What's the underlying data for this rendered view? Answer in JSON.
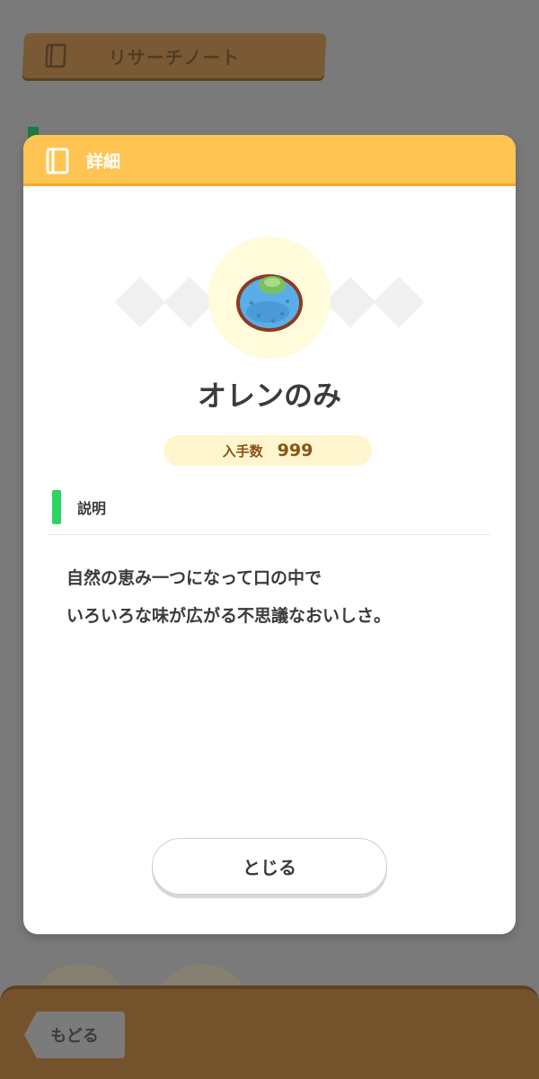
{
  "background": {
    "header_title": "リサーチノート",
    "back_button_label": "もどる"
  },
  "modal": {
    "header_title": "詳細",
    "item_name": "オレンのみ",
    "count_label": "入手数",
    "count_value": "999",
    "section_label": "説明",
    "description_lines": [
      "自然の恵み一つになって口の中で",
      "いろいろな味が広がる不思議なおいしさ。"
    ],
    "close_button_label": "とじる"
  },
  "colors": {
    "header_yellow": "#ffc452",
    "section_green": "#2bd560",
    "count_text": "#8a5314",
    "bottom_bar_brown": "#74522b"
  },
  "icons": {
    "header": "book-icon",
    "item": "oran-berry-icon"
  }
}
